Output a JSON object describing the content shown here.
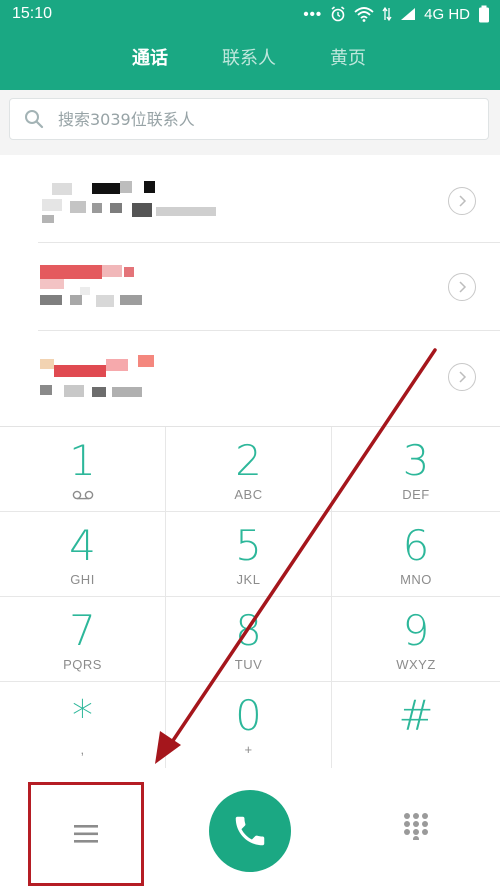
{
  "status_bar": {
    "time": "15:10",
    "dots": "•••",
    "network": "4G HD",
    "icons": [
      "alarm-icon",
      "wifi-icon",
      "data-arrows-icon",
      "signal-icon",
      "battery-icon"
    ]
  },
  "tabs": [
    {
      "label": "通话",
      "active": true
    },
    {
      "label": "联系人",
      "active": false
    },
    {
      "label": "黄页",
      "active": false
    }
  ],
  "search": {
    "placeholder": "搜索3039位联系人"
  },
  "dialpad": {
    "keys": [
      {
        "num": "1",
        "sub": ""
      },
      {
        "num": "2",
        "sub": "ABC"
      },
      {
        "num": "3",
        "sub": "DEF"
      },
      {
        "num": "4",
        "sub": "GHI"
      },
      {
        "num": "5",
        "sub": "JKL"
      },
      {
        "num": "6",
        "sub": "MNO"
      },
      {
        "num": "7",
        "sub": "PQRS"
      },
      {
        "num": "8",
        "sub": "TUV"
      },
      {
        "num": "9",
        "sub": "WXYZ"
      },
      {
        "num": "*",
        "sub": ","
      },
      {
        "num": "0",
        "sub": "+"
      },
      {
        "num": "#",
        "sub": ""
      }
    ]
  },
  "colors": {
    "accent": "#1aa883",
    "digit": "#2db79a",
    "highlight_box": "#b51d24",
    "annotation_arrow": "#a5161c"
  }
}
